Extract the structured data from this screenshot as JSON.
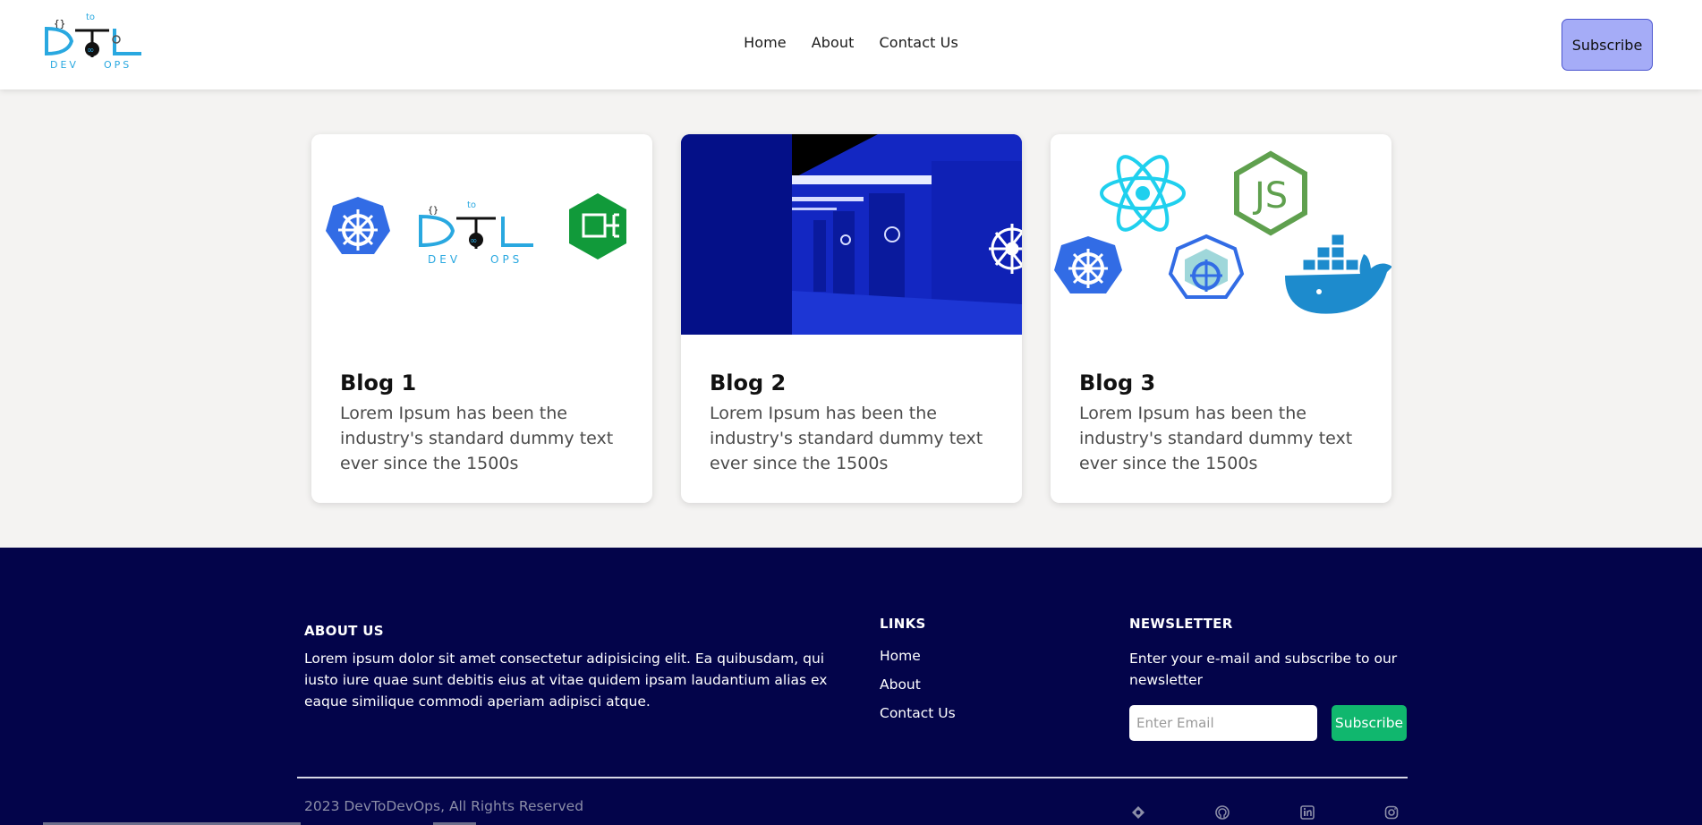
{
  "header": {
    "logo_alt": "DevToDevOps logo",
    "nav": [
      "Home",
      "About",
      "Contact Us"
    ],
    "subscribe_label": "Subscribe"
  },
  "blogs": [
    {
      "title": "Blog 1",
      "text": "Lorem Ipsum has been the industry's standard dummy text ever since the 1500s"
    },
    {
      "title": "Blog 2",
      "text": "Lorem Ipsum has been the industry's standard dummy text ever since the 1500s"
    },
    {
      "title": "Blog 3",
      "text": "Lorem Ipsum has been the industry's standard dummy text ever since the 1500s"
    }
  ],
  "footer": {
    "about_title": "ABOUT US",
    "about_text": "Lorem ipsum dolor sit amet consectetur adipisicing elit. Ea quibusdam, qui iusto iure quae sunt debitis eius at vitae quidem ipsam laudantium alias ex eaque similique commodi aperiam adipisci atque.",
    "links_title": "LINKS",
    "links": [
      "Home",
      "About",
      "Contact Us"
    ],
    "newsletter_title": "NEWSLETTER",
    "newsletter_text": "Enter your e-mail and subscribe to our newsletter",
    "email_placeholder": "Enter Email",
    "subscribe_label": "Subscribe",
    "copyright": "2023 DevToDevOps, All Rights Reserved",
    "social_icons": [
      "diamond-icon",
      "github-icon",
      "linkedin-icon",
      "instagram-icon"
    ]
  },
  "colors": {
    "header_bg": "#ffffff",
    "page_bg": "#f4f3f2",
    "footer_bg": "#03044a",
    "header_subscribe_bg": "#a5acf7",
    "footer_subscribe_bg": "#10b76e",
    "kubernetes_blue": "#326ce5",
    "logo_cyan": "#29a8e0"
  }
}
